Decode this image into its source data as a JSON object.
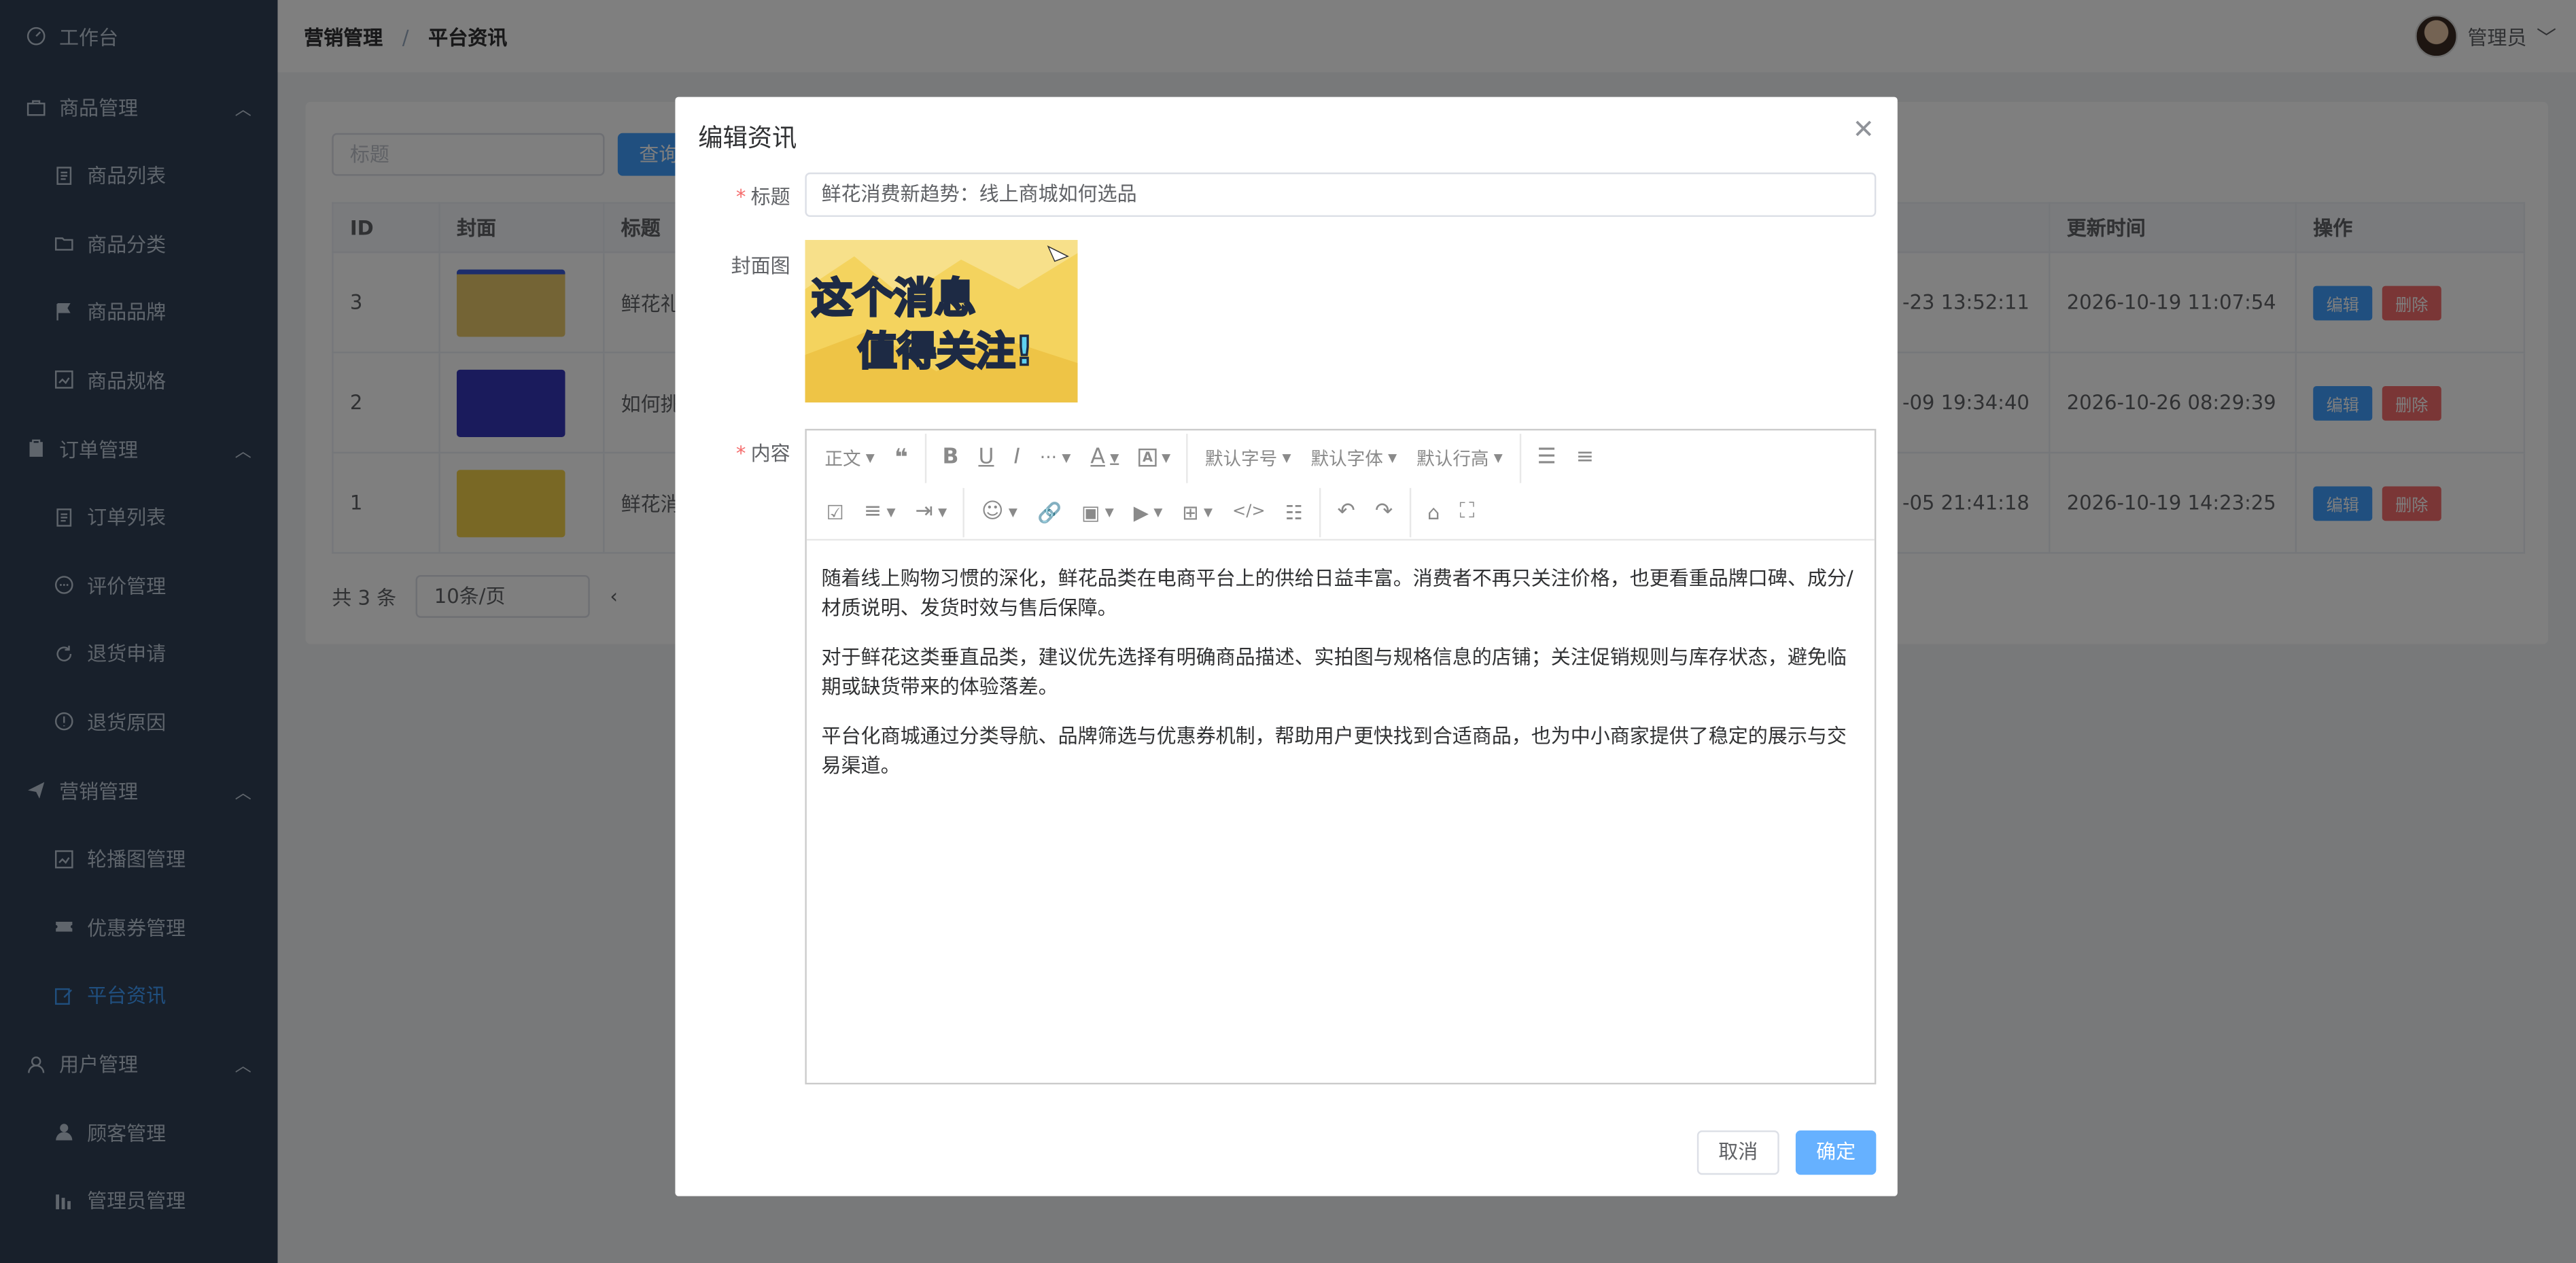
{
  "sidebar": {
    "workbench": "工作台",
    "groups": [
      {
        "label": "商品管理",
        "items": [
          "商品列表",
          "商品分类",
          "商品品牌",
          "商品规格"
        ]
      },
      {
        "label": "订单管理",
        "items": [
          "订单列表",
          "评价管理",
          "退货申请",
          "退货原因"
        ]
      },
      {
        "label": "营销管理",
        "items": [
          "轮播图管理",
          "优惠券管理",
          "平台资讯"
        ]
      },
      {
        "label": "用户管理",
        "items": [
          "顾客管理",
          "管理员管理"
        ]
      }
    ],
    "active_item": "平台资讯"
  },
  "header": {
    "breadcrumb": [
      "营销管理",
      "平台资讯"
    ],
    "breadcrumb_sep": "/",
    "user_name": "管理员"
  },
  "list": {
    "search_placeholder": "标题",
    "query_button": "查询",
    "columns": [
      "ID",
      "封面",
      "标题",
      "",
      "更新时间",
      "操作"
    ],
    "rows": [
      {
        "id": "3",
        "title": "鲜花礼",
        "created": "-23 13:52:11",
        "updated": "2026-10-19 11:07:54"
      },
      {
        "id": "2",
        "title": "如何挑",
        "created": "-09 19:34:40",
        "updated": "2026-10-26 08:29:39"
      },
      {
        "id": "1",
        "title": "鲜花消",
        "created": "-05 21:41:18",
        "updated": "2026-10-19 14:23:25"
      }
    ],
    "edit_label": "编辑",
    "delete_label": "删除",
    "total": "共 3 条",
    "page_size": "10条/页"
  },
  "dialog": {
    "title": "编辑资讯",
    "title_label": "标题",
    "title_value": "鲜花消费新趋势：线上商城如何选品",
    "cover_label": "封面图",
    "cover_text_1": "这个消息",
    "cover_text_2": "值得关注!",
    "content_label": "内容",
    "toolbar": {
      "heading": "正文",
      "font_size": "默认字号",
      "font_family": "默认字体",
      "line_height": "默认行高"
    },
    "content": [
      "随着线上购物习惯的深化，鲜花品类在电商平台上的供给日益丰富。消费者不再只关注价格，也更看重品牌口碑、成分/材质说明、发货时效与售后保障。",
      "对于鲜花这类垂直品类，建议优先选择有明确商品描述、实拍图与规格信息的店铺；关注促销规则与库存状态，避免临期或缺货带来的体验落差。",
      "平台化商城通过分类导航、品牌筛选与优惠券机制，帮助用户更快找到合适商品，也为中小商家提供了稳定的展示与交易渠道。"
    ],
    "cancel": "取消",
    "confirm": "确定"
  }
}
